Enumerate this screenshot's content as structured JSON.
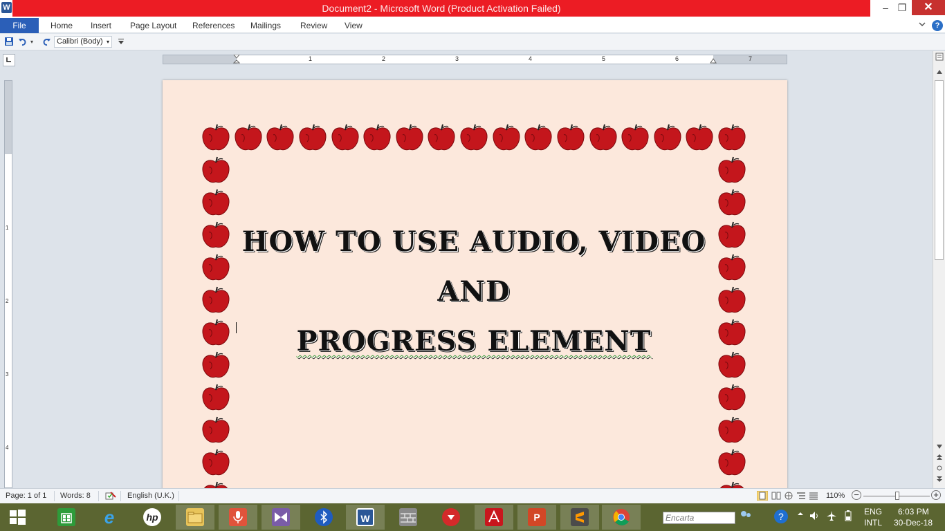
{
  "window": {
    "title": "Document2 - Microsoft Word (Product Activation Failed)",
    "app_letter": "W",
    "minimize": "–",
    "restore": "❐",
    "close": "✕"
  },
  "ribbon": {
    "tabs": [
      "File",
      "Home",
      "Insert",
      "Page Layout",
      "References",
      "Mailings",
      "Review",
      "View"
    ],
    "help": "?",
    "collapse": "♡"
  },
  "qat": {
    "font_name": "Calibri (Body)",
    "dropdown_glyph": "▾"
  },
  "ruler": {
    "numbers": [
      "1",
      "1",
      "2",
      "3",
      "4",
      "5",
      "6",
      "7"
    ]
  },
  "vruler": {
    "numbers": [
      "1",
      "2",
      "3",
      "4"
    ]
  },
  "document": {
    "title_line1": "HOW TO USE AUDIO, VIDEO AND",
    "title_line2": "PROGRESS  ELEMENT",
    "border_color": "#c4161c",
    "page_color": "#fce8dc"
  },
  "status": {
    "page": "Page: 1 of 1",
    "words": "Words: 8",
    "language": "English (U.K.)",
    "zoom": "110%",
    "zoom_minus": "−",
    "zoom_plus": "+"
  },
  "taskbar": {
    "search_placeholder": "Encarta",
    "lang_top": "ENG",
    "lang_bottom": "INTL",
    "time": "6:03 PM",
    "date": "30-Dec-18",
    "items": [
      "start",
      "store",
      "internet-explorer",
      "hp",
      "file-explorer",
      "voice-recorder",
      "visual-studio",
      "bluetooth",
      "word",
      "wall-app",
      "download-app",
      "acrobat",
      "powerpoint",
      "sublime",
      "chrome"
    ]
  },
  "colors": {
    "title_bar": "#ec1c24",
    "file_tab": "#2b5fb8",
    "taskbar": "#5b6531"
  }
}
